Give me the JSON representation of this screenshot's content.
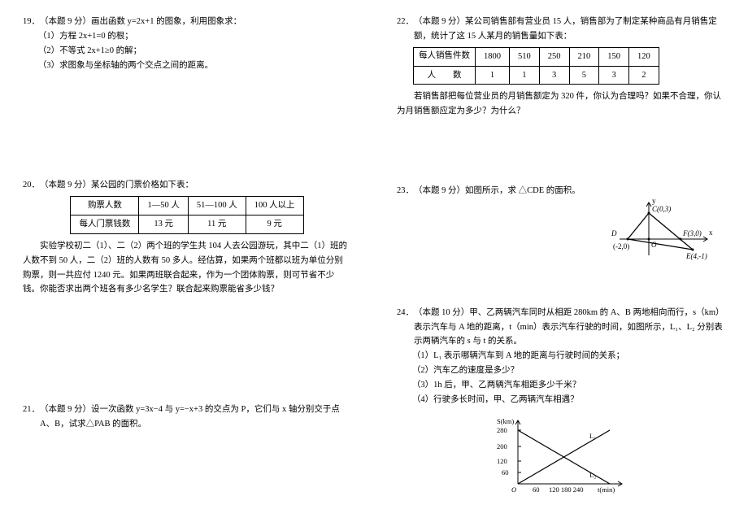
{
  "left": {
    "q19": {
      "num": "19．",
      "stem": "（本题 9 分）画出函数 y=2x+1 的图象，利用图象求：",
      "s1": "（1）方程 2x+1=0 的根；",
      "s2": "（2）不等式 2x+1≥0 的解；",
      "s3": "（3）求图象与坐标轴的两个交点之间的距离。"
    },
    "q20": {
      "num": "20．",
      "stem": "（本题 9 分）某公园的门票价格如下表：",
      "table": {
        "r1c1": "购票人数",
        "r1c2": "1—50 人",
        "r1c3": "51—100 人",
        "r1c4": "100 人以上",
        "r2c1": "每人门票钱数",
        "r2c2": "13 元",
        "r2c3": "11 元",
        "r2c4": "9 元"
      },
      "p": "　　实验学校初二（1）、二（2）两个班的学生共 104 人去公园游玩，其中二（1）班的人数不到 50 人，二（2）班的人数有 50 多人。经估算，如果两个班都以班为单位分别购票，则一共应付 1240 元。如果两班联合起来，作为一个团体购票，则可节省不少钱。你能否求出两个班各有多少名学生？联合起来购票能省多少钱？"
    },
    "q21": {
      "num": "21．",
      "stem": "（本题 9 分）设一次函数 y=3x−4 与 y=−x+3 的交点为 P，它们与 x 轴分别交于点 A、B，试求△PAB 的面积。"
    }
  },
  "right": {
    "q22": {
      "num": "22．",
      "stem": "（本题 9 分）某公司销售部有营业员 15 人，销售部为了制定某种商品有月销售定额，统计了这 15 人某月的销售量如下表：",
      "table": {
        "r1c1": "每人销售件数",
        "r1c2": "1800",
        "r1c3": "510",
        "r1c4": "250",
        "r1c5": "210",
        "r1c6": "150",
        "r1c7": "120",
        "r2c1": "人　　数",
        "r2c2": "1",
        "r2c3": "1",
        "r2c4": "3",
        "r2c5": "5",
        "r2c6": "3",
        "r2c7": "2"
      },
      "p": "　　若销售部把每位营业员的月销售额定为 320 件，你认为合理吗？如果不合理，你认为月销售额应定为多少？为什么？"
    },
    "q23": {
      "num": "23．",
      "stem": "（本题 9 分）如图所示，求 △CDE 的面积。",
      "pts": {
        "C": "C(0,3)",
        "D": "D(-2,0)",
        "O": "O",
        "F": "F(3,0)",
        "E": "E(4,-1)",
        "x": "x",
        "y": "y"
      }
    },
    "q24": {
      "num": "24．",
      "stem": "（本题 10 分）甲、乙两辆汽车同时从相距 280km 的 A、B 两地相向而行，s（km）表示汽车与 A 地的距离，t（min）表示汽车行驶的时间，如图所示，L₁、L₂ 分别表示两辆汽车的 s 与 t 的关系。",
      "s1": "（1）L₁ 表示哪辆汽车到 A 地的距离与行驶时间的关系；",
      "s2": "（2）汽车乙的速度是多少？",
      "s3": "（3）1h 后，甲、乙两辆汽车相距多少千米？",
      "s4": "（4）行驶多长时间，甲、乙两辆汽车相遇？",
      "chart_data": {
        "type": "line",
        "xlabel": "t(min)",
        "ylabel": "S(km)",
        "x_ticks": [
          0,
          60,
          120,
          180,
          240
        ],
        "y_ticks": [
          0,
          60,
          120,
          200,
          280
        ],
        "series": [
          {
            "name": "L1",
            "points": [
              [
                0,
                0
              ],
              [
                240,
                280
              ]
            ]
          },
          {
            "name": "L2",
            "points": [
              [
                0,
                280
              ],
              [
                240,
                0
              ]
            ]
          }
        ],
        "note": "Lines intersect near middle; both axes start at O"
      },
      "fig_labels": {
        "yTop": "280",
        "y200": "200",
        "y120": "120",
        "y60": "60",
        "o": "O",
        "x60": "60",
        "xrest": "120 180 240",
        "xaxis": "t(min)",
        "yaxis": "S(km)",
        "L1": "L₁",
        "L2": "L₂"
      }
    }
  }
}
